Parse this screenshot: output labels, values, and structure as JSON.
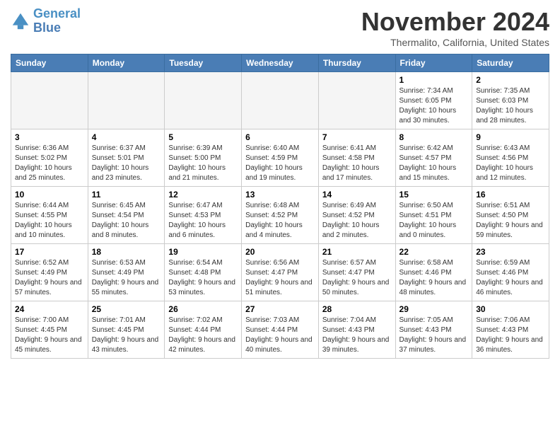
{
  "header": {
    "logo_line1": "General",
    "logo_line2": "Blue",
    "title": "November 2024",
    "location": "Thermalito, California, United States"
  },
  "days_of_week": [
    "Sunday",
    "Monday",
    "Tuesday",
    "Wednesday",
    "Thursday",
    "Friday",
    "Saturday"
  ],
  "weeks": [
    [
      {
        "day": "",
        "info": "",
        "empty": true
      },
      {
        "day": "",
        "info": "",
        "empty": true
      },
      {
        "day": "",
        "info": "",
        "empty": true
      },
      {
        "day": "",
        "info": "",
        "empty": true
      },
      {
        "day": "",
        "info": "",
        "empty": true
      },
      {
        "day": "1",
        "info": "Sunrise: 7:34 AM\nSunset: 6:05 PM\nDaylight: 10 hours and 30 minutes.",
        "empty": false
      },
      {
        "day": "2",
        "info": "Sunrise: 7:35 AM\nSunset: 6:03 PM\nDaylight: 10 hours and 28 minutes.",
        "empty": false
      }
    ],
    [
      {
        "day": "3",
        "info": "Sunrise: 6:36 AM\nSunset: 5:02 PM\nDaylight: 10 hours and 25 minutes.",
        "empty": false
      },
      {
        "day": "4",
        "info": "Sunrise: 6:37 AM\nSunset: 5:01 PM\nDaylight: 10 hours and 23 minutes.",
        "empty": false
      },
      {
        "day": "5",
        "info": "Sunrise: 6:39 AM\nSunset: 5:00 PM\nDaylight: 10 hours and 21 minutes.",
        "empty": false
      },
      {
        "day": "6",
        "info": "Sunrise: 6:40 AM\nSunset: 4:59 PM\nDaylight: 10 hours and 19 minutes.",
        "empty": false
      },
      {
        "day": "7",
        "info": "Sunrise: 6:41 AM\nSunset: 4:58 PM\nDaylight: 10 hours and 17 minutes.",
        "empty": false
      },
      {
        "day": "8",
        "info": "Sunrise: 6:42 AM\nSunset: 4:57 PM\nDaylight: 10 hours and 15 minutes.",
        "empty": false
      },
      {
        "day": "9",
        "info": "Sunrise: 6:43 AM\nSunset: 4:56 PM\nDaylight: 10 hours and 12 minutes.",
        "empty": false
      }
    ],
    [
      {
        "day": "10",
        "info": "Sunrise: 6:44 AM\nSunset: 4:55 PM\nDaylight: 10 hours and 10 minutes.",
        "empty": false
      },
      {
        "day": "11",
        "info": "Sunrise: 6:45 AM\nSunset: 4:54 PM\nDaylight: 10 hours and 8 minutes.",
        "empty": false
      },
      {
        "day": "12",
        "info": "Sunrise: 6:47 AM\nSunset: 4:53 PM\nDaylight: 10 hours and 6 minutes.",
        "empty": false
      },
      {
        "day": "13",
        "info": "Sunrise: 6:48 AM\nSunset: 4:52 PM\nDaylight: 10 hours and 4 minutes.",
        "empty": false
      },
      {
        "day": "14",
        "info": "Sunrise: 6:49 AM\nSunset: 4:52 PM\nDaylight: 10 hours and 2 minutes.",
        "empty": false
      },
      {
        "day": "15",
        "info": "Sunrise: 6:50 AM\nSunset: 4:51 PM\nDaylight: 10 hours and 0 minutes.",
        "empty": false
      },
      {
        "day": "16",
        "info": "Sunrise: 6:51 AM\nSunset: 4:50 PM\nDaylight: 9 hours and 59 minutes.",
        "empty": false
      }
    ],
    [
      {
        "day": "17",
        "info": "Sunrise: 6:52 AM\nSunset: 4:49 PM\nDaylight: 9 hours and 57 minutes.",
        "empty": false
      },
      {
        "day": "18",
        "info": "Sunrise: 6:53 AM\nSunset: 4:49 PM\nDaylight: 9 hours and 55 minutes.",
        "empty": false
      },
      {
        "day": "19",
        "info": "Sunrise: 6:54 AM\nSunset: 4:48 PM\nDaylight: 9 hours and 53 minutes.",
        "empty": false
      },
      {
        "day": "20",
        "info": "Sunrise: 6:56 AM\nSunset: 4:47 PM\nDaylight: 9 hours and 51 minutes.",
        "empty": false
      },
      {
        "day": "21",
        "info": "Sunrise: 6:57 AM\nSunset: 4:47 PM\nDaylight: 9 hours and 50 minutes.",
        "empty": false
      },
      {
        "day": "22",
        "info": "Sunrise: 6:58 AM\nSunset: 4:46 PM\nDaylight: 9 hours and 48 minutes.",
        "empty": false
      },
      {
        "day": "23",
        "info": "Sunrise: 6:59 AM\nSunset: 4:46 PM\nDaylight: 9 hours and 46 minutes.",
        "empty": false
      }
    ],
    [
      {
        "day": "24",
        "info": "Sunrise: 7:00 AM\nSunset: 4:45 PM\nDaylight: 9 hours and 45 minutes.",
        "empty": false
      },
      {
        "day": "25",
        "info": "Sunrise: 7:01 AM\nSunset: 4:45 PM\nDaylight: 9 hours and 43 minutes.",
        "empty": false
      },
      {
        "day": "26",
        "info": "Sunrise: 7:02 AM\nSunset: 4:44 PM\nDaylight: 9 hours and 42 minutes.",
        "empty": false
      },
      {
        "day": "27",
        "info": "Sunrise: 7:03 AM\nSunset: 4:44 PM\nDaylight: 9 hours and 40 minutes.",
        "empty": false
      },
      {
        "day": "28",
        "info": "Sunrise: 7:04 AM\nSunset: 4:43 PM\nDaylight: 9 hours and 39 minutes.",
        "empty": false
      },
      {
        "day": "29",
        "info": "Sunrise: 7:05 AM\nSunset: 4:43 PM\nDaylight: 9 hours and 37 minutes.",
        "empty": false
      },
      {
        "day": "30",
        "info": "Sunrise: 7:06 AM\nSunset: 4:43 PM\nDaylight: 9 hours and 36 minutes.",
        "empty": false
      }
    ]
  ]
}
